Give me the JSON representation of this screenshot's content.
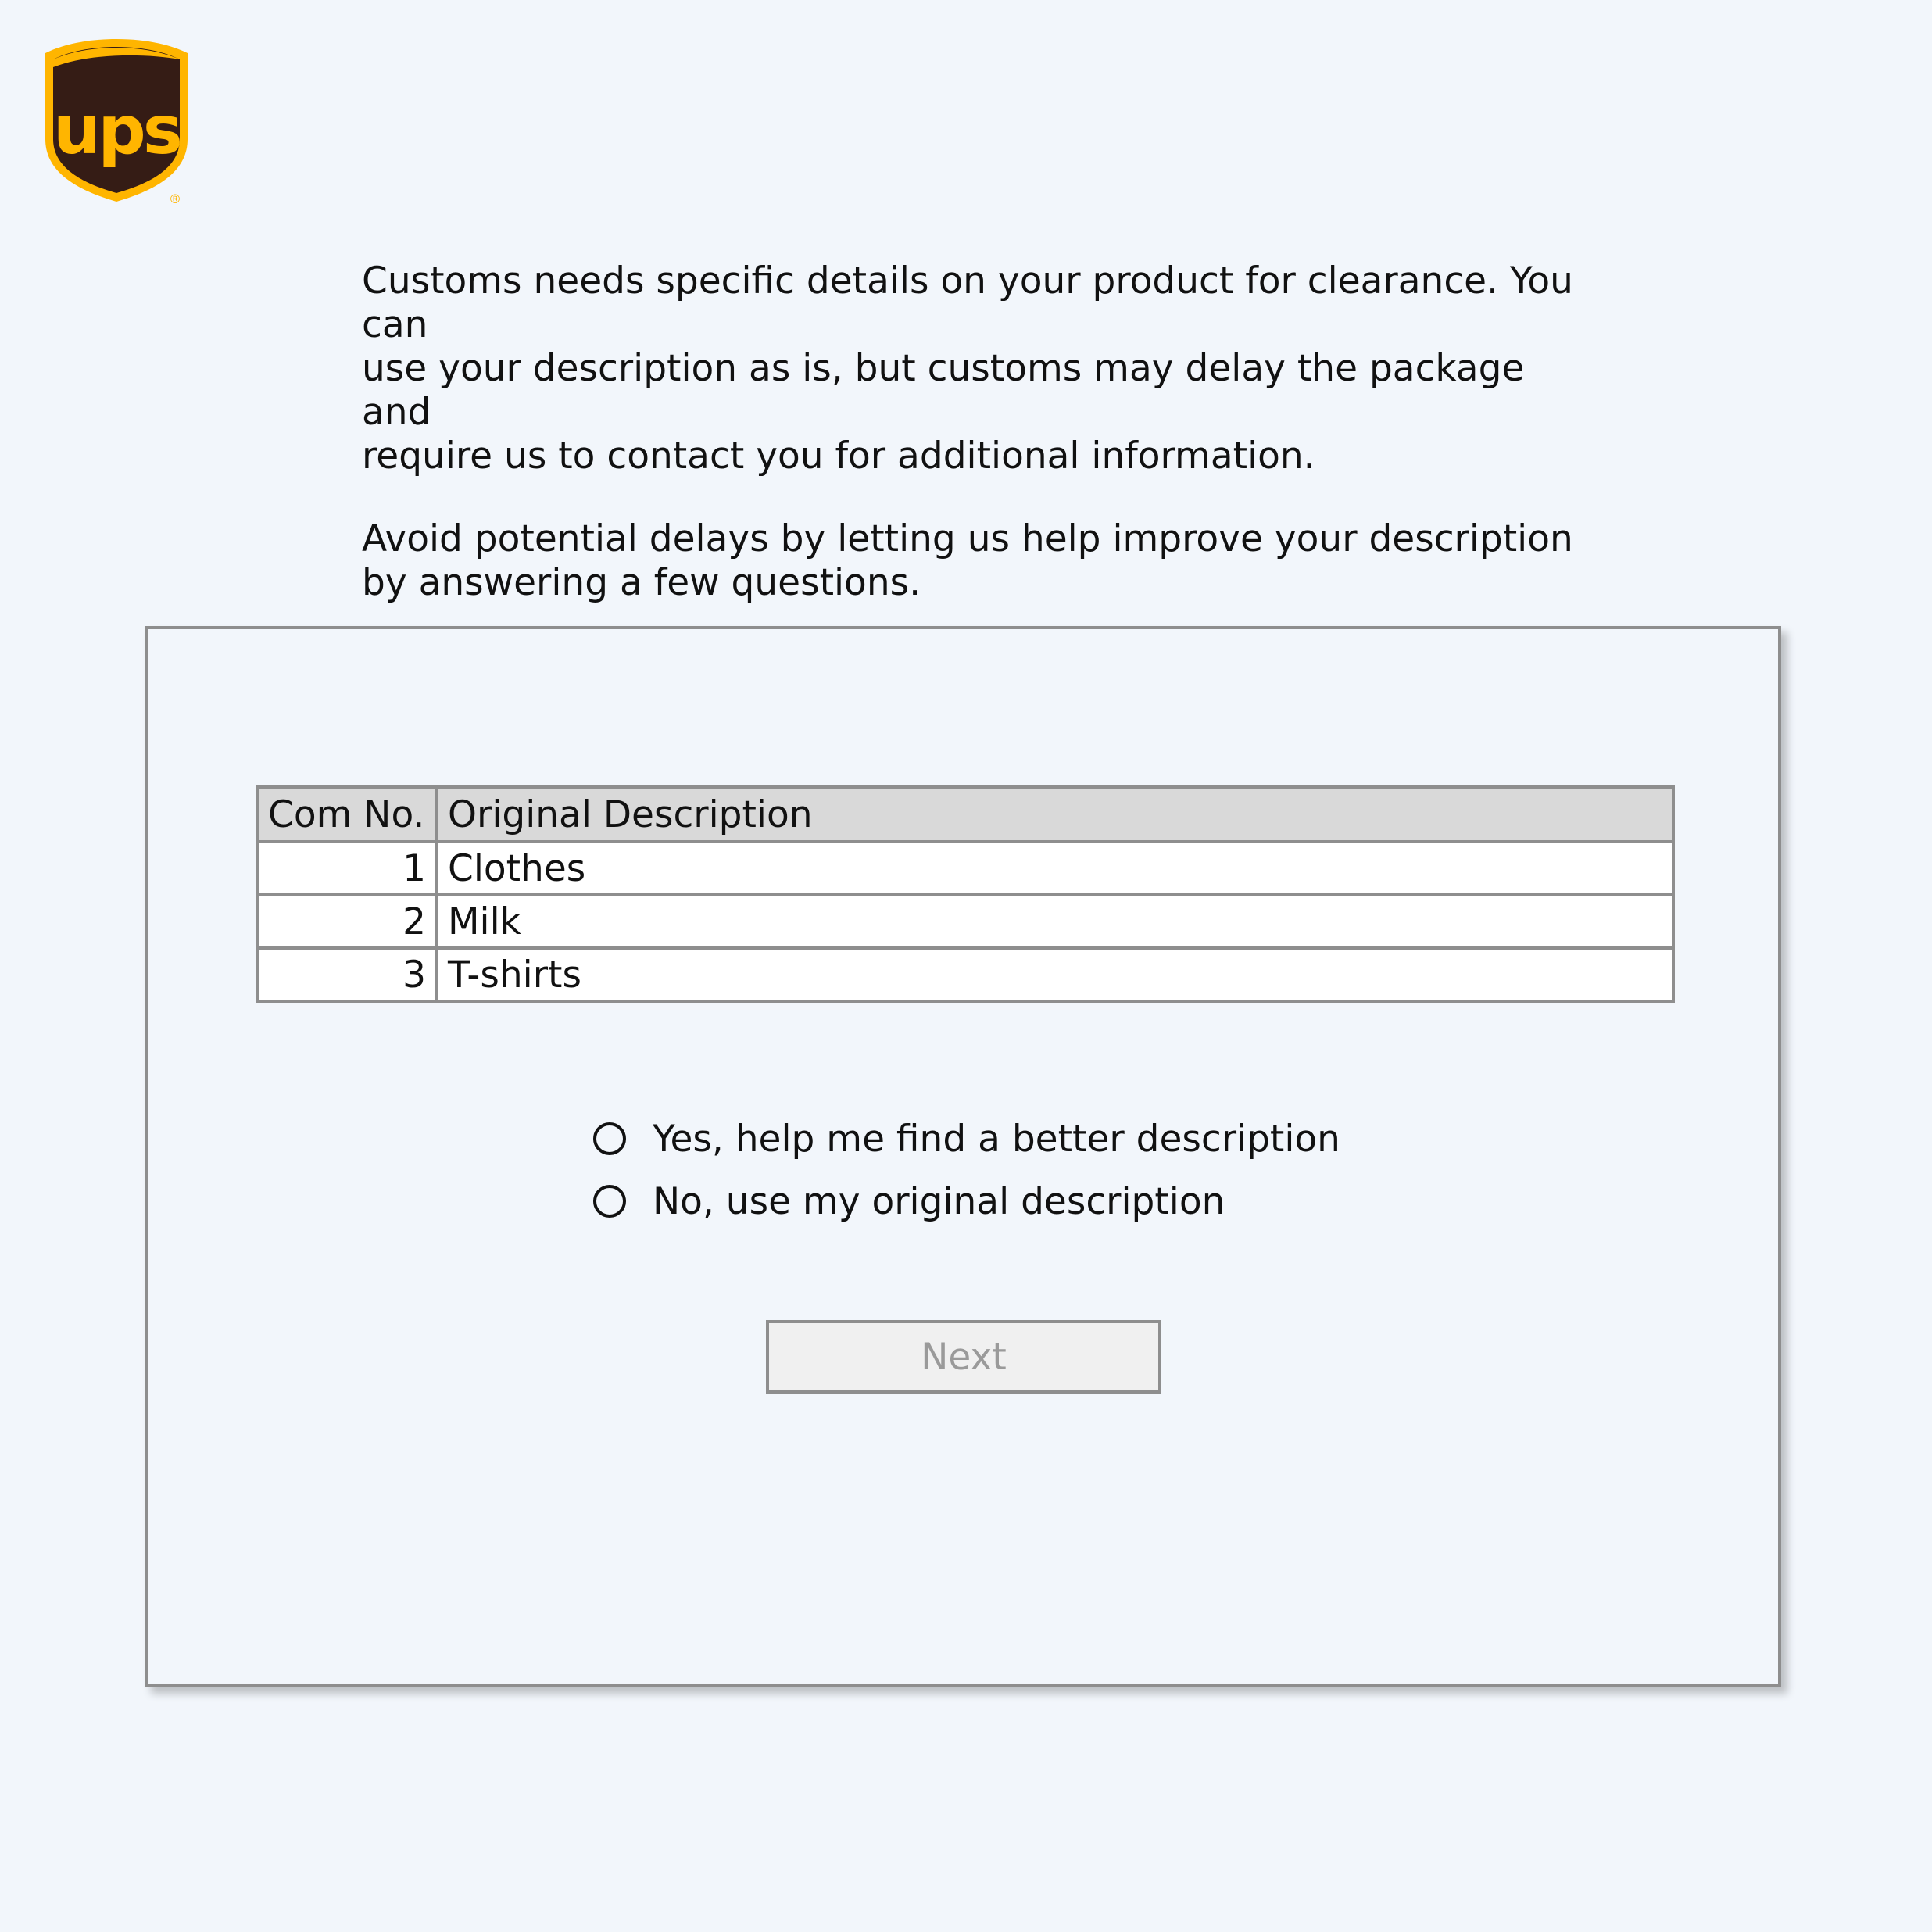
{
  "logo": {
    "wordmark": "ups",
    "registered_mark": "®",
    "colors": {
      "shield": "#351c15",
      "gold": "#ffb500"
    }
  },
  "intro": {
    "paragraph1": "Customs needs specific details on your product for clearance. You can\nuse your description as is, but customs may delay the package and\nrequire us to contact you for additional information.",
    "paragraph2": "Avoid potential delays by letting us help improve your description\nby answering a few questions."
  },
  "table": {
    "headers": [
      "Com No.",
      "Original Description"
    ],
    "rows": [
      {
        "num": "1",
        "desc": "Clothes"
      },
      {
        "num": "2",
        "desc": "Milk"
      },
      {
        "num": "3",
        "desc": "T-shirts"
      }
    ]
  },
  "options": [
    {
      "label": "Yes, help me find a better description",
      "selected": false
    },
    {
      "label": "No, use my original description",
      "selected": false
    }
  ],
  "next_button": {
    "label": "Next",
    "enabled": false
  }
}
